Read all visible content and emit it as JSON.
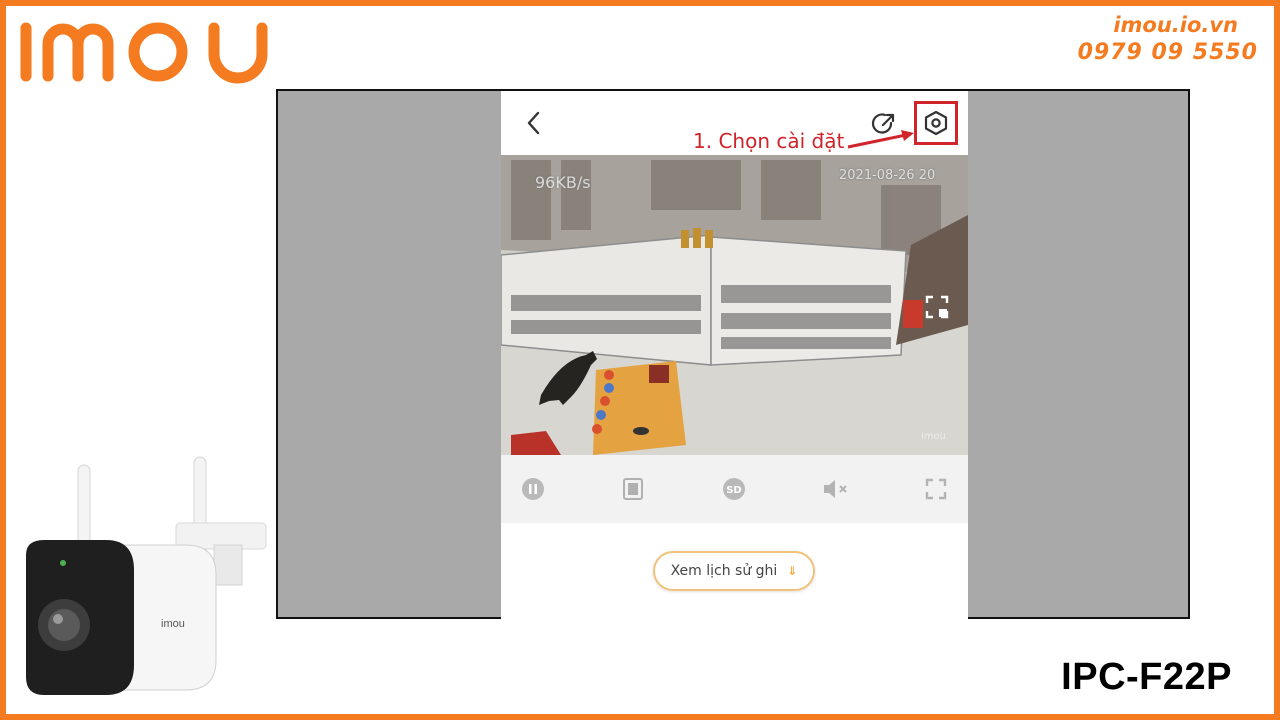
{
  "brand": {
    "logo_text": "imou",
    "website": "imou.io.vn",
    "phone": "0979 09 5550",
    "accent_color": "#f47b20"
  },
  "app_screen": {
    "topbar": {
      "back_icon": "chevron-left-icon",
      "share_icon": "share-icon",
      "settings_icon": "settings-hexagon-icon"
    },
    "annotation": {
      "text": "1. Chọn cài đặt",
      "color": "#d0232a"
    },
    "video": {
      "bitrate": "96KB/s",
      "timestamp": "2021-08-26 20",
      "brand_watermark": "imou"
    },
    "controls": [
      {
        "name": "pause-button",
        "icon": "pause-icon"
      },
      {
        "name": "snapshot-button",
        "icon": "snapshot-icon"
      },
      {
        "name": "quality-button",
        "icon": "sd-icon",
        "label": "SD"
      },
      {
        "name": "mute-button",
        "icon": "speaker-muted-icon"
      },
      {
        "name": "fullscreen-button",
        "icon": "fullscreen-icon"
      }
    ],
    "history_button": {
      "label": "Xem lịch sử ghi",
      "icon": "chevron-down-icon"
    }
  },
  "product": {
    "model": "IPC-F22P",
    "camera_logo": "imou"
  }
}
